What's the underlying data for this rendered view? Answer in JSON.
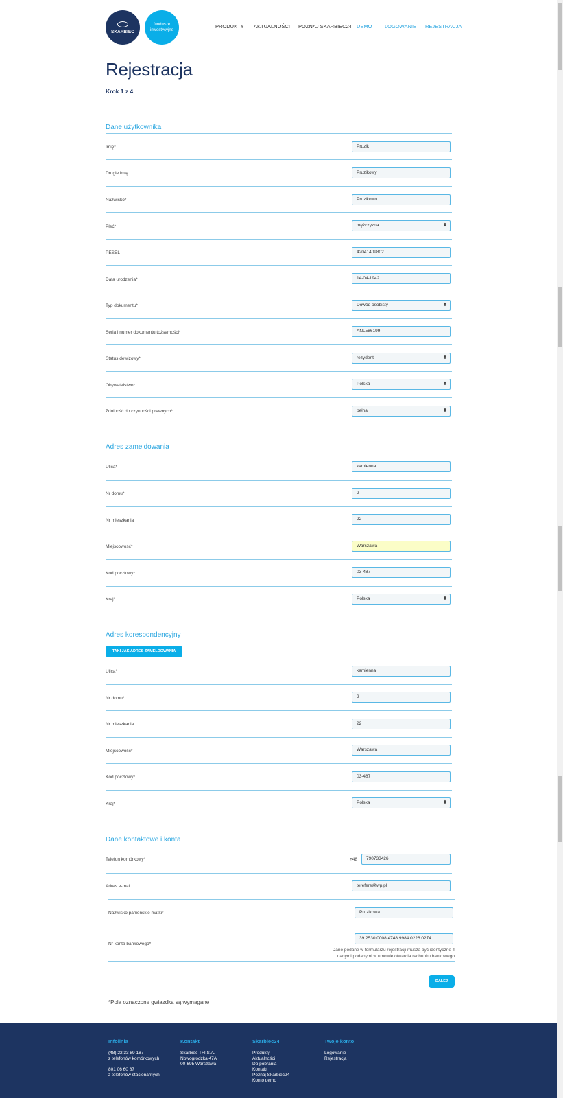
{
  "header": {
    "logo_main": "SKARBIEC",
    "logo_second_line1": "fundusze",
    "logo_second_line2": "inwestycyjne",
    "nav": [
      "PRODUKTY",
      "AKTUALNOŚCI",
      "POZNAJ SKARBIEC24",
      "DEMO",
      "LOGOWANIE",
      "REJESTRACJA"
    ]
  },
  "page": {
    "title": "Rejestracja",
    "step": "Krok 1 z 4"
  },
  "user_data": {
    "title": "Dane użytkownika",
    "fields": [
      {
        "label": "Imię*",
        "value": "Pruzik"
      },
      {
        "label": "Drugie imię",
        "value": "Pruzikowy"
      },
      {
        "label": "Nazwisko*",
        "value": "Pruzikowo"
      },
      {
        "label": "Płeć*",
        "value": "mężczyzna"
      },
      {
        "label": "PESEL",
        "value": "42041409802"
      },
      {
        "label": "Data urodzenia*",
        "value": "14-04-1942"
      },
      {
        "label": "Typ dokumentu*",
        "value": "Dowód osobisty"
      },
      {
        "label": "Seria i numer dokumentu tożsamości*",
        "value": "ANL586199"
      },
      {
        "label": "Status dewizowy*",
        "value": "rezydent"
      },
      {
        "label": "Obywatelstwo*",
        "value": "Polska"
      },
      {
        "label": "Zdolność do czynności prawnych*",
        "value": "pełna"
      }
    ]
  },
  "registered_address": {
    "title": "Adres zameldowania",
    "fields": [
      {
        "label": "Ulica*",
        "value": "kamienna"
      },
      {
        "label": "Nr domu*",
        "value": "2"
      },
      {
        "label": "Nr mieszkania",
        "value": "22"
      },
      {
        "label": "Miejscowość*",
        "value": "Warszawa"
      },
      {
        "label": "Kod pocztowy*",
        "value": "03-487"
      },
      {
        "label": "Kraj*",
        "value": "Polska"
      }
    ]
  },
  "correspondence_address": {
    "title": "Adres korespondencyjny",
    "copy_button": "TAKI JAK ADRES ZAMELDOWANIA",
    "fields": [
      {
        "label": "Ulica*",
        "value": "kamienna"
      },
      {
        "label": "Nr domu*",
        "value": "2"
      },
      {
        "label": "Nr mieszkania",
        "value": "22"
      },
      {
        "label": "Miejscowość*",
        "value": "Warszawa"
      },
      {
        "label": "Kod pocztowy*",
        "value": "03-487"
      },
      {
        "label": "Kraj*",
        "value": "Polska"
      }
    ]
  },
  "contact": {
    "title": "Dane kontaktowe i konta",
    "phone_label": "Telefon komórkowy*",
    "phone_prefix": "+48",
    "phone_value": "790733426",
    "email_label": "Adres e-mail",
    "email_value": "terefere@wp.pl",
    "maiden_label": "Nazwisko panieńskie matki*",
    "maiden_value": "Pruzikowa",
    "account_label": "Nr konta bankowego*",
    "account_value": "39 2530 0008 4748 9984 0226 0274",
    "account_note_line1": "Dane podane w formularzu rejestracji muszą być identyczne z",
    "account_note_line2": "danymi podanymi w umowie otwarcia rachunku bankowego"
  },
  "actions": {
    "next": "DALEJ",
    "required_note": "*Pola oznaczone gwiazdką są wymagane"
  },
  "footer": {
    "infolinia": {
      "title": "Infolinia",
      "line1": "(48) 22 33 89 187",
      "line2": "z telefonów komórkowych",
      "line3": "801 06 60 87",
      "line4": "z telefonów stacjonarnych"
    },
    "kontakt": {
      "title": "Kontakt",
      "line1": "Skarbiec TFI S.A.",
      "line2": "Nowogrodzka 47A",
      "line3": "00-695 Warszawa"
    },
    "skarbiec24": {
      "title": "Skarbiec24",
      "items": [
        "Produkty",
        "Aktualności",
        "Do pobrania",
        "Kontakt",
        "Poznaj Skarbiec24",
        "Konto demo"
      ]
    },
    "konto": {
      "title": "Twoje konto",
      "items": [
        "Logowanie",
        "Rejestracja"
      ]
    }
  },
  "colors": {
    "navy": "#1d3461",
    "accent": "#2aa6e0",
    "button": "#0aaee8"
  }
}
